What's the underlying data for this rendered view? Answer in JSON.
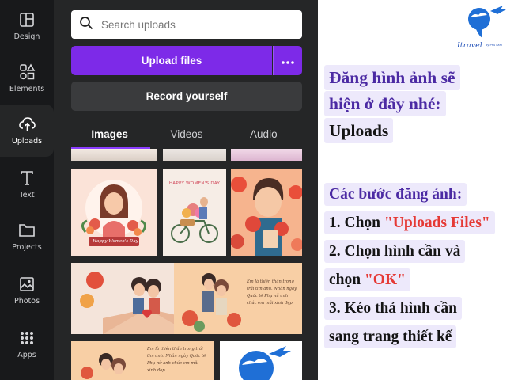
{
  "sidebar": {
    "items": [
      {
        "label": "Design",
        "icon": "design-icon"
      },
      {
        "label": "Elements",
        "icon": "elements-icon"
      },
      {
        "label": "Uploads",
        "icon": "uploads-icon",
        "active": true
      },
      {
        "label": "Text",
        "icon": "text-icon"
      },
      {
        "label": "Projects",
        "icon": "folder-icon"
      },
      {
        "label": "Photos",
        "icon": "photos-icon"
      },
      {
        "label": "Apps",
        "icon": "apps-icon"
      }
    ]
  },
  "panel": {
    "search_placeholder": "Search uploads",
    "upload_label": "Upload files",
    "record_label": "Record yourself",
    "tabs": [
      "Images",
      "Videos",
      "Audio"
    ],
    "active_tab": "Images"
  },
  "thumbnails": {
    "card1_text": "Happy Women's Day",
    "card2_text": "HAPPY WOMEN'S DAY",
    "poem1": "Em là thiên thần trong trái tim anh. Nhân ngày Quốc tế Phụ nữ anh chúc em mãi xinh đẹp",
    "poem2": "Em là thiên thần trong trái tim anh. Nhân ngày Quốc tế Phụ nữ anh chúc em mãi xinh đẹp"
  },
  "logo": {
    "brand": "Itravel",
    "tagline": "by Phú Lâm"
  },
  "article": {
    "heading_line1": "Đăng hình ảnh sẽ",
    "heading_line2": "hiện ở đây nhé:",
    "heading_line3": "Uploads",
    "steps_title": "Các bước đăng ảnh:",
    "step1_prefix": "1. Chọn ",
    "step1_highlight": "\"Uploads Files\"",
    "step2_line1": "2. Chọn hình cần và",
    "step2_prefix": "chọn ",
    "step2_highlight": "\"OK\"",
    "step3_line1": "3. Kéo thả hình cần",
    "step3_line2": "sang trang thiết kế"
  },
  "colors": {
    "accent": "#7d2ae8",
    "heading": "#4b2aa3",
    "highlight_red": "#e53935",
    "panel_bg": "#252627",
    "rail_bg": "#18191b"
  }
}
